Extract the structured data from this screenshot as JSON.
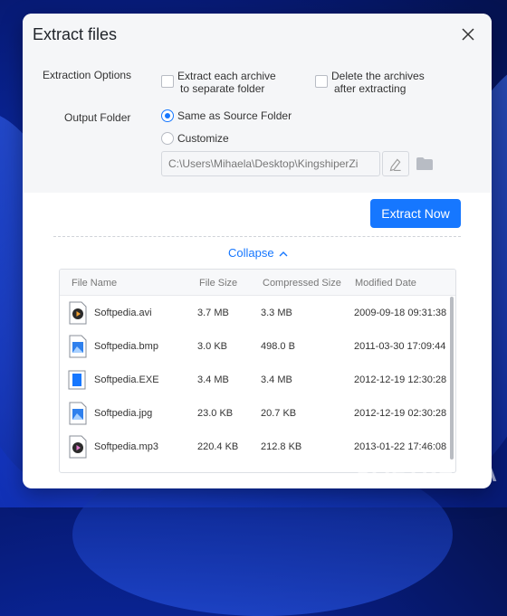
{
  "dialog": {
    "title": "Extract files"
  },
  "options": {
    "section_label": "Extraction Options",
    "separate_folder": {
      "line1": "Extract each archive",
      "line2": "to separate folder",
      "checked": false
    },
    "delete_archives": {
      "line1": "Delete the archives",
      "line2": "after extracting",
      "checked": false
    },
    "output_label": "Output Folder",
    "radio_same": "Same as Source Folder",
    "radio_custom": "Customize",
    "selected": "same",
    "path_value": "C:\\Users\\Mihaela\\Desktop\\KingshiperZi"
  },
  "actions": {
    "extract_label": "Extract Now",
    "collapse_label": "Collapse"
  },
  "table": {
    "columns": [
      "File Name",
      "File Size",
      "Compressed Size",
      "Modified Date"
    ],
    "rows": [
      {
        "name": "Softpedia.avi",
        "size": "3.7 MB",
        "compressed": "3.3 MB",
        "modified": "2009-09-18 09:31:38",
        "icon": "video-file-icon"
      },
      {
        "name": "Softpedia.bmp",
        "size": "3.0 KB",
        "compressed": "498.0 B",
        "modified": "2011-03-30 17:09:44",
        "icon": "image-file-icon"
      },
      {
        "name": "Softpedia.EXE",
        "size": "3.4 MB",
        "compressed": "3.4 MB",
        "modified": "2012-12-19 12:30:28",
        "icon": "exe-file-icon"
      },
      {
        "name": "Softpedia.jpg",
        "size": "23.0 KB",
        "compressed": "20.7 KB",
        "modified": "2012-12-19 02:30:28",
        "icon": "image-file-icon"
      },
      {
        "name": "Softpedia.mp3",
        "size": "220.4 KB",
        "compressed": "212.8 KB",
        "modified": "2013-01-22 17:46:08",
        "icon": "audio-file-icon"
      }
    ]
  },
  "watermark": "SOFTPEDIA",
  "colors": {
    "accent": "#1677ff",
    "panel": "#f5f6f8"
  }
}
